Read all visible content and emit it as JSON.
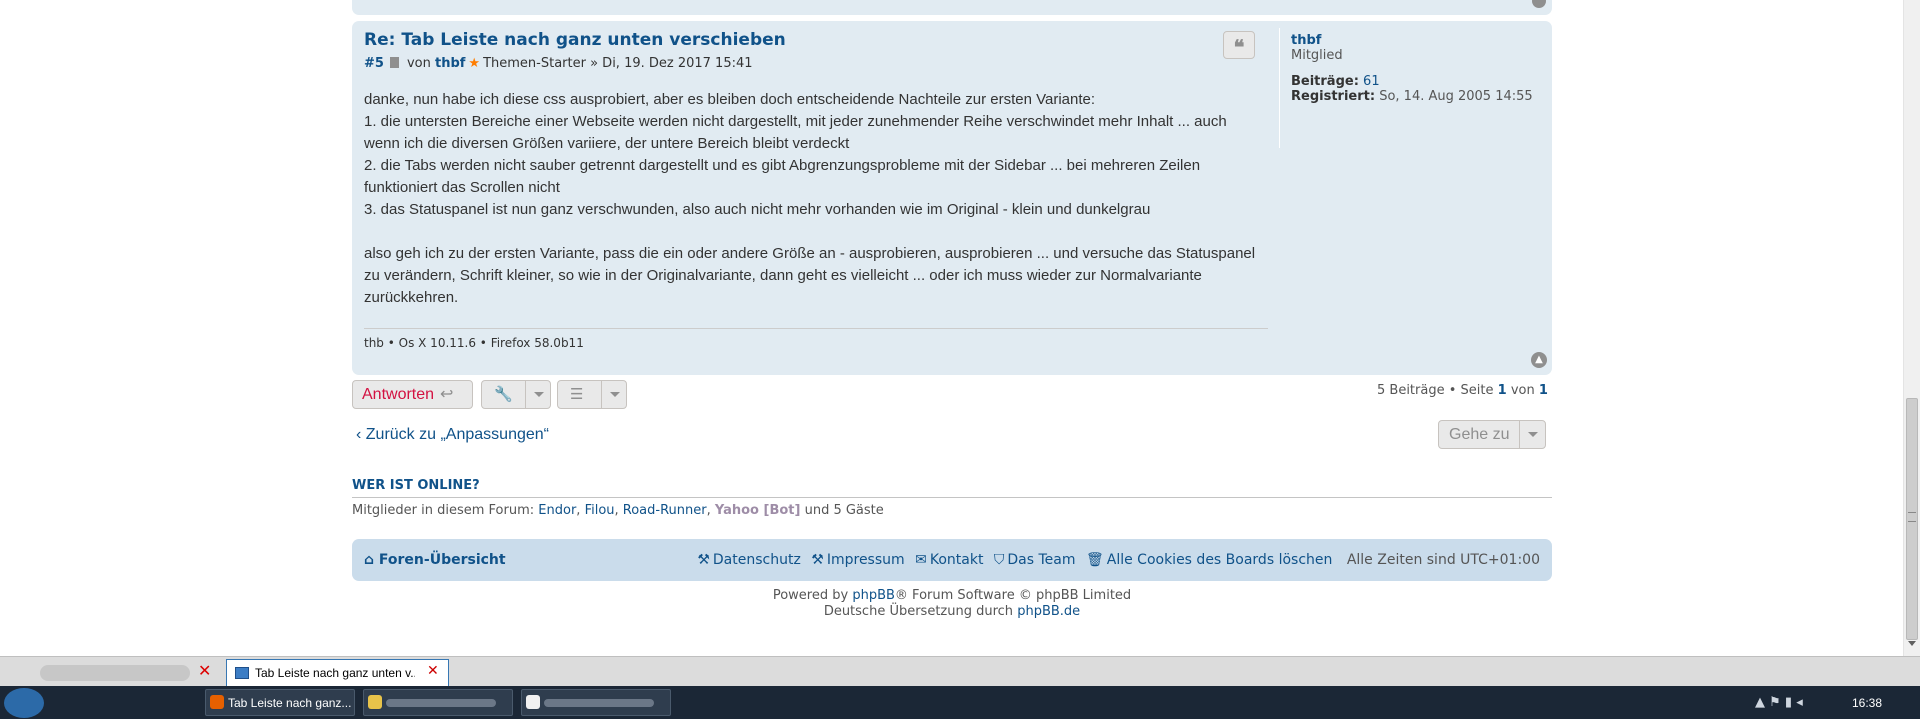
{
  "post": {
    "title": "Re: Tab Leiste nach ganz unten verschieben",
    "number": "#5",
    "by_label": "von",
    "author": "thbf",
    "author_role": "Themen-Starter",
    "date": "» Di, 19. Dez 2017 15:41",
    "quote_label": "❝",
    "body": [
      "danke, nun habe ich diese css ausprobiert, aber es bleiben doch entscheidende Nachteile zur ersten Variante:",
      "1. die untersten Bereiche einer Webseite werden nicht dargestellt, mit jeder zunehmender Reihe verschwindet mehr Inhalt ... auch wenn ich die diversen Größen variiere, der untere Bereich bleibt verdeckt",
      "2. die Tabs werden nicht sauber getrennt dargestellt und es gibt Abgrenzungsprobleme mit der Sidebar ... bei mehreren Zeilen funktioniert das Scrollen nicht",
      "3. das Statuspanel ist nun ganz verschwunden, also auch nicht mehr vorhanden wie im Original - klein und dunkelgrau",
      "",
      "also geh ich zu der ersten Variante, pass die ein oder andere Größe an - ausprobieren, ausprobieren ... und versuche das Statuspanel zu verändern, Schrift kleiner, so wie in der Originalvariante, dann geht es vielleicht ... oder ich muss wieder zur Normalvariante zurückkehren."
    ],
    "signature": "thb • Os X 10.11.6 • Firefox 58.0b11",
    "profile": {
      "username": "thbf",
      "rank": "Mitglied",
      "posts_label": "Beiträge:",
      "posts_value": "61",
      "registered_label": "Registriert:",
      "registered_value": "So, 14. Aug 2005 14:55"
    }
  },
  "actions": {
    "reply_label": "Antworten",
    "pagination_prefix": "5 Beiträge • Seite",
    "page_current": "1",
    "page_of": "von",
    "page_total": "1",
    "back_label": "Zurück zu „Anpassungen“",
    "goto_label": "Gehe zu"
  },
  "online": {
    "title": "WER IST ONLINE?",
    "prefix": "Mitglieder in diesem Forum:",
    "members": [
      "Endor",
      "Filou",
      "Road-Runner"
    ],
    "bot": "Yahoo [Bot]",
    "suffix": "und 5 Gäste"
  },
  "footer": {
    "home_label": "Foren-Übersicht",
    "links": [
      "Datenschutz",
      "Impressum",
      "Kontakt",
      "Das Team",
      "Alle Cookies des Boards löschen"
    ],
    "timezone": "Alle Zeiten sind UTC+01:00",
    "powered_prefix": "Powered by",
    "powered_link": "phpBB",
    "powered_suffix": "® Forum Software © phpBB Limited",
    "translation_prefix": "Deutsche Übersetzung durch",
    "translation_link": "phpBB.de"
  },
  "browser": {
    "active_tab_title": "Tab Leiste nach ganz unten v..."
  },
  "taskbar": {
    "firefox_item": "Tab Leiste nach ganz...",
    "clock": "16:38"
  },
  "colors": {
    "link": "#105289",
    "post_bg": "#e1ebf2",
    "nav_bg": "#cadceb",
    "reply": "#d31141",
    "star": "#ff7d00"
  }
}
